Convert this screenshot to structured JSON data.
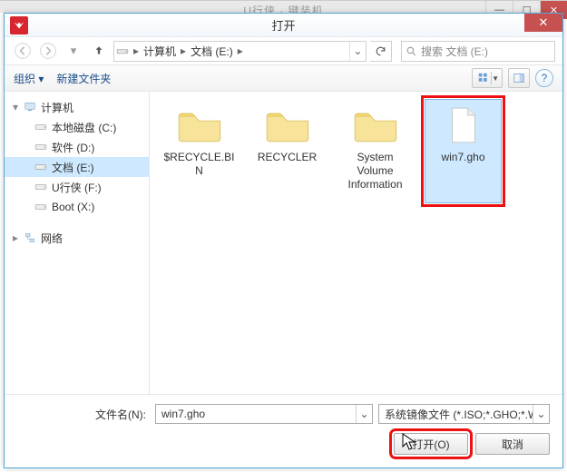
{
  "bg_window": {
    "title": "U行侠 · 键装机"
  },
  "dialog": {
    "title": "打开",
    "breadcrumb": {
      "root": "计算机",
      "folder": "文档 (E:)"
    },
    "search_placeholder": "搜索 文档 (E:)",
    "toolbar": {
      "organize": "组织 ▾",
      "new_folder": "新建文件夹"
    }
  },
  "nav": {
    "computer": "计算机",
    "items": [
      {
        "label": "本地磁盘 (C:)"
      },
      {
        "label": "软件 (D:)"
      },
      {
        "label": "文档 (E:)",
        "selected": true
      },
      {
        "label": "U行侠 (F:)"
      },
      {
        "label": "Boot (X:)"
      }
    ],
    "network": "网络"
  },
  "files": [
    {
      "name": "$RECYCLE.BIN",
      "type": "folder"
    },
    {
      "name": "RECYCLER",
      "type": "folder"
    },
    {
      "name": "System Volume Information",
      "type": "folder"
    },
    {
      "name": "win7.gho",
      "type": "file",
      "selected": true,
      "highlight": true
    }
  ],
  "footer": {
    "filename_label": "文件名(N):",
    "filename_value": "win7.gho",
    "filter_value": "系统镜像文件 (*.ISO;*.GHO;*.W",
    "open_label": "打开(O)",
    "cancel_label": "取消"
  }
}
